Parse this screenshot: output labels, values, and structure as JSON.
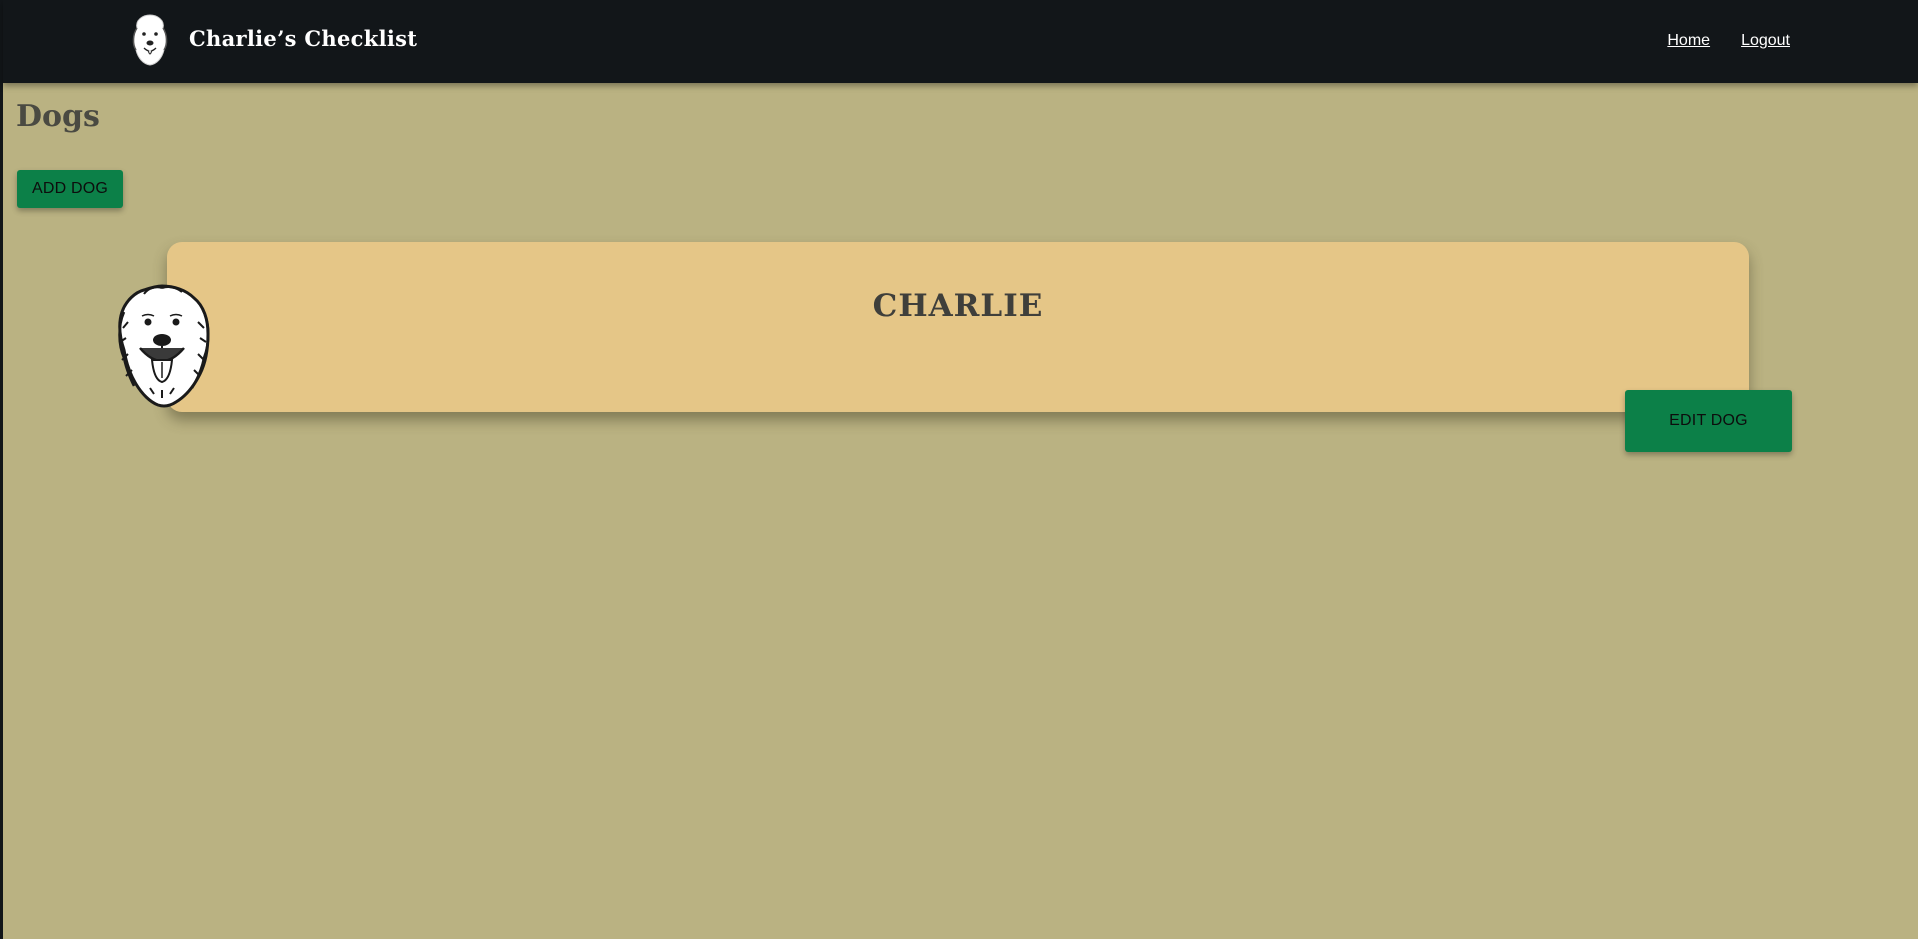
{
  "header": {
    "brand_name": "Charlie’s Checklist",
    "logo_icon": "golden-retriever-logo-icon",
    "nav": [
      {
        "label": "Home"
      },
      {
        "label": "Logout"
      }
    ]
  },
  "main": {
    "title": "Dogs",
    "add_button_label": "ADD DOG",
    "dogs": [
      {
        "name": "CHARLIE",
        "avatar_icon": "dog-face-icon",
        "edit_button_label": "EDIT DOG"
      }
    ]
  },
  "colors": {
    "nav_background": "#121619",
    "page_background": "#bab282",
    "card_background": "#e5c687",
    "button_green": "#0c8048",
    "heading_text": "#4a4a42"
  }
}
